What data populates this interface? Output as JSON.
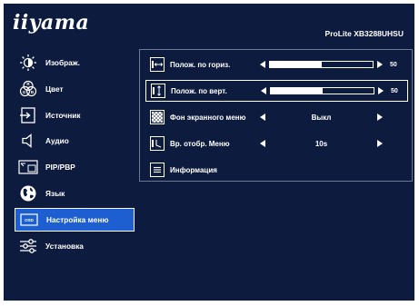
{
  "brand": "iiyama",
  "model": "ProLite XB3288UHSU",
  "sidebar": {
    "items": [
      {
        "label": "Изображ.",
        "icon": "brightness-icon"
      },
      {
        "label": "Цвет",
        "icon": "rgb-icon"
      },
      {
        "label": "Источник",
        "icon": "input-icon"
      },
      {
        "label": "Аудио",
        "icon": "speaker-icon"
      },
      {
        "label": "PIP/PBP",
        "icon": "pip-icon"
      },
      {
        "label": "Язык",
        "icon": "globe-icon"
      },
      {
        "label": "Настройка меню",
        "icon": "osd-icon",
        "active": true
      },
      {
        "label": "Установка",
        "icon": "settings-sliders-icon"
      }
    ]
  },
  "menu": {
    "rows": [
      {
        "label": "Полож. по гориз.",
        "type": "slider",
        "value": "50",
        "level": 0.5
      },
      {
        "label": "Полож. по верт.",
        "type": "slider",
        "value": "50",
        "level": 0.5,
        "active": true
      },
      {
        "label": "Фон экранного меню",
        "type": "option",
        "value": "Выкл"
      },
      {
        "label": "Вр. отобр. Меню",
        "type": "option",
        "value": "10s"
      },
      {
        "label": "Информация",
        "type": "plain"
      }
    ]
  },
  "colors": {
    "background": "#0d1b3e",
    "highlight": "#1d5fd1",
    "text": "#ffffff"
  }
}
